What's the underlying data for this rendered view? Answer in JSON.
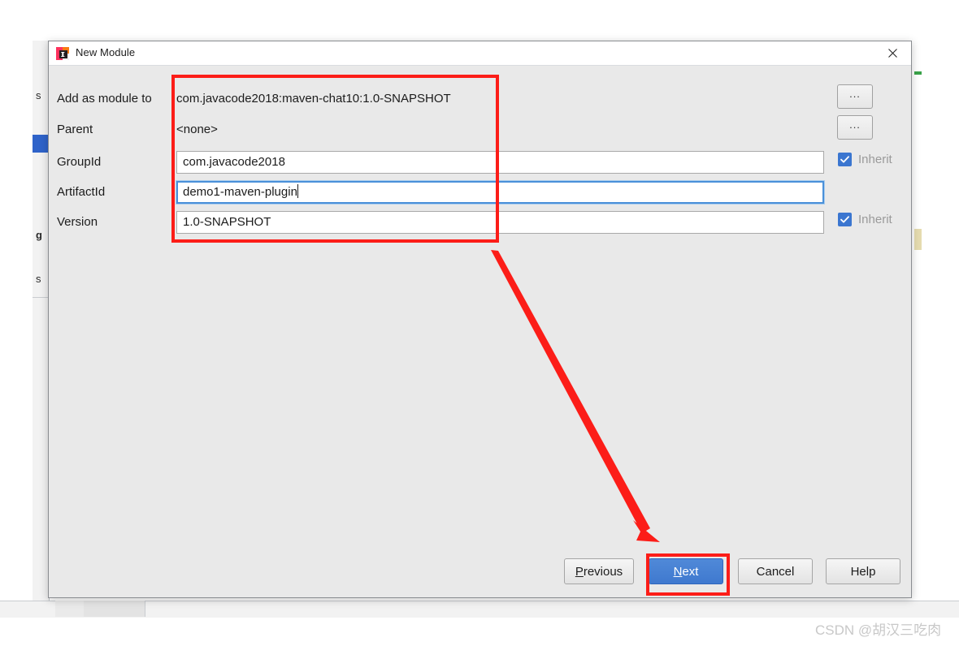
{
  "window": {
    "title": "New Module",
    "app_icon": "intellij-idea-icon",
    "close_icon": "close-icon"
  },
  "form": {
    "rows": [
      {
        "label": "Add as module to",
        "type": "static",
        "value": "com.javacode2018:maven-chat10:1.0-SNAPSHOT",
        "control": "ellipsis",
        "control_label": "..."
      },
      {
        "label": "Parent",
        "type": "static",
        "value": "<none>",
        "control": "ellipsis",
        "control_label": "..."
      },
      {
        "label": "GroupId",
        "type": "input",
        "value": "com.javacode2018",
        "placeholder": "",
        "focused": false,
        "control": "checkbox",
        "control_label": "Inherit",
        "checked": true
      },
      {
        "label": "ArtifactId",
        "type": "input",
        "value": "demo1-maven-plugin",
        "placeholder": "",
        "focused": true,
        "control": "none",
        "control_label": "",
        "checked": false
      },
      {
        "label": "Version",
        "type": "input",
        "value": "1.0-SNAPSHOT",
        "placeholder": "",
        "focused": false,
        "control": "checkbox",
        "control_label": "Inherit",
        "checked": true
      }
    ]
  },
  "buttons": {
    "previous": {
      "label": "Previous",
      "mnemonic": "P",
      "primary": false
    },
    "next": {
      "label": "Next",
      "mnemonic": "N",
      "primary": true
    },
    "cancel": {
      "label": "Cancel",
      "mnemonic": "",
      "primary": false
    },
    "help": {
      "label": "Help",
      "mnemonic": "",
      "primary": false
    }
  },
  "annotations": {
    "accent_color": "#fc1d18",
    "fields_highlight": "red rectangle around form fields",
    "next_highlight": "red rectangle around Next button",
    "arrow": "red arrow from fields box to Next button"
  },
  "background": {
    "tree_fragments": [
      "s",
      "g",
      "s"
    ],
    "selection_color": "#2f63c9",
    "marker_green": "#3aa34a",
    "marker_tan": "#e6dcb0"
  },
  "watermark": {
    "text": "CSDN @胡汉三吃肉"
  }
}
